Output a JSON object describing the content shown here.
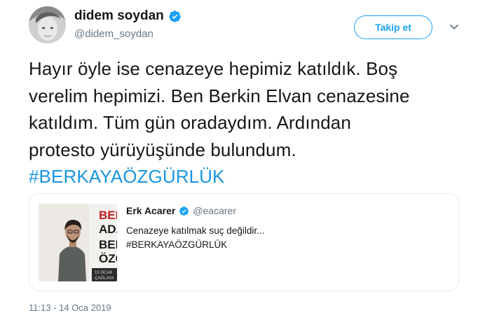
{
  "author": {
    "name": "didem soydan",
    "handle": "@didem_soydan",
    "verified_icon": "verified-badge-icon"
  },
  "follow_button": {
    "label": "Takip et"
  },
  "menu": {
    "icon": "chevron-down-icon"
  },
  "tweet": {
    "lines": [
      "Hayır öyle ise cenazeye hepimiz katıldık. Boş",
      "verelim hepimizi. Ben Berkin Elvan cenazesine",
      "katıldım. Tüm gün oradaydım. Ardından",
      "protesto yürüyüşünde bulundum."
    ],
    "hashtag": "#BERKAYAÖZGÜRLÜK"
  },
  "quoted_tweet": {
    "name": "Erk Acarer",
    "handle": "@eacarer",
    "text_line1": "Cenazeye katılmak suç değildir...",
    "text_line2": "#BERKAYAÖZGÜRLÜK",
    "image_poster_text": [
      "BER",
      "ADA",
      "BER",
      "ÖZG"
    ],
    "image_footer_text": [
      "15 OCAK",
      "ÇAĞLAYA"
    ]
  },
  "timestamp": "11:13 - 14 Oca 2019",
  "colors": {
    "accent": "#1da1f2",
    "hashtag": "#1b95e0",
    "muted": "#657786",
    "border": "#e1e8ed"
  }
}
